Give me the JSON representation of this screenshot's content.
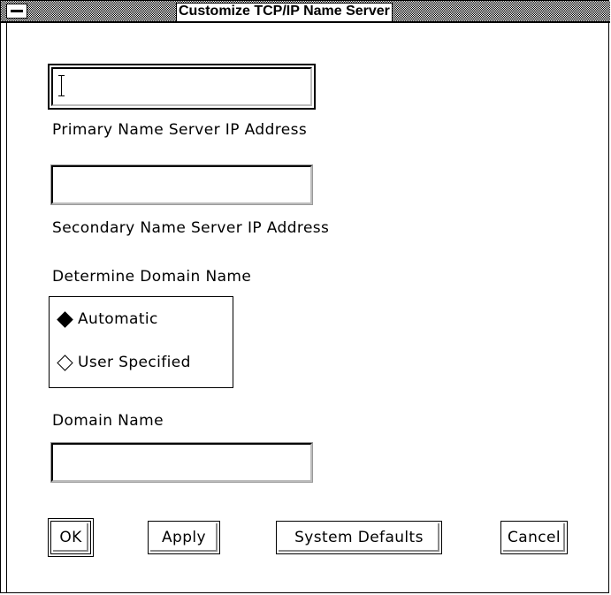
{
  "window": {
    "title": "Customize TCP/IP Name Server"
  },
  "fields": {
    "primary_ip": {
      "value": "",
      "label": "Primary Name Server IP Address"
    },
    "secondary_ip": {
      "value": "",
      "label": "Secondary Name Server IP Address"
    },
    "domain_name": {
      "value": "",
      "label": "Domain Name"
    }
  },
  "domain_mode": {
    "label": "Determine Domain Name",
    "options": [
      {
        "label": "Automatic",
        "selected": true
      },
      {
        "label": "User Specified",
        "selected": false
      }
    ]
  },
  "buttons": {
    "ok": "OK",
    "apply": "Apply",
    "system_defaults": "System Defaults",
    "cancel": "Cancel"
  }
}
